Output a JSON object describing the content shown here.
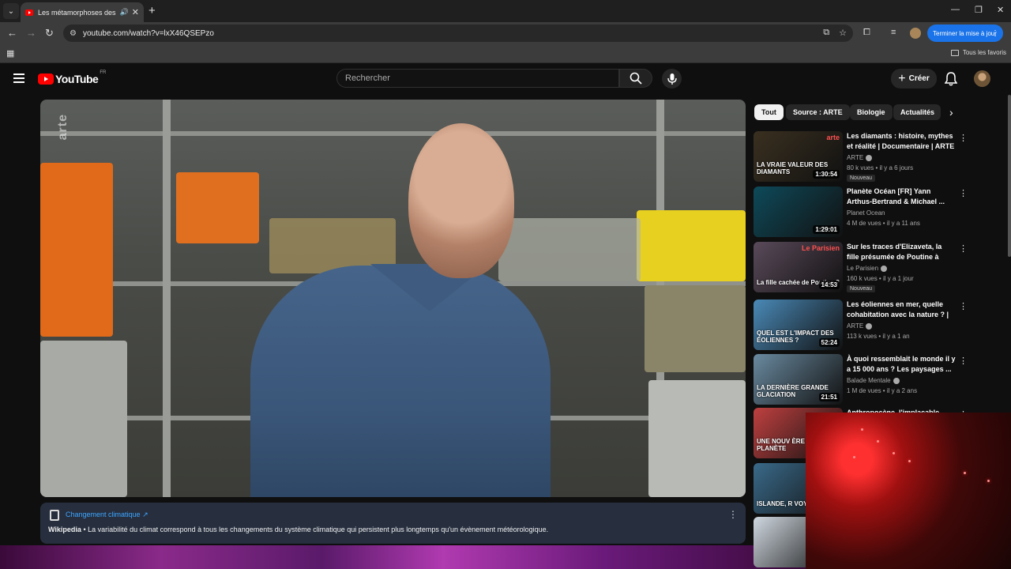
{
  "browser": {
    "tab_title": "Les métamorphoses des gl",
    "url": "youtube.com/watch?v=lxX46QSEPzo",
    "update_button": "Terminer la mise à jour",
    "bookmarks_all": "Tous les favoris"
  },
  "youtube": {
    "logo_text": "YouTube",
    "country_code": "FR",
    "search_placeholder": "Rechercher",
    "create_label": "Créer"
  },
  "player": {
    "watermark": "arte"
  },
  "info_panel": {
    "topic": "Changement climatique",
    "source": "Wikipedia",
    "text": " • La variabilité du climat correspond à tous les changements du système climatique qui persistent plus longtemps qu'un évènement météorologique."
  },
  "chips": [
    "Tout",
    "Source : ARTE",
    "Biologie",
    "Actualités"
  ],
  "recommendations": [
    {
      "title": "Les diamants : histoire, mythes et réalité | Documentaire | ARTE",
      "channel": "ARTE",
      "verified": true,
      "meta": "80 k vues • il y a 6 jours",
      "badge": "Nouveau",
      "duration": "1:30:54",
      "thumb_text": "LA VRAIE VALEUR DES DIAMANTS",
      "thumb_brand": "arte",
      "thumb_color": "#3a3020"
    },
    {
      "title": "Planète Océan [FR] Yann Arthus-Bertrand & Michael ...",
      "channel": "Planet Ocean",
      "verified": false,
      "meta": "4 M de vues • il y a 11 ans",
      "badge": "",
      "duration": "1:29:01",
      "thumb_text": "",
      "thumb_color": "#0e4a5a"
    },
    {
      "title": "Sur les traces d'Elizaveta, la fille présumée de Poutine à Paris",
      "channel": "Le Parisien",
      "verified": true,
      "meta": "160 k vues • il y a 1 jour",
      "badge": "Nouveau",
      "duration": "14:53",
      "thumb_text": "La fille cachée de Poutine ?",
      "thumb_brand": "Le Parisien",
      "thumb_color": "#5a4a5a"
    },
    {
      "title": "Les éoliennes en mer, quelle cohabitation avec la nature ? | ...",
      "channel": "ARTE",
      "verified": true,
      "meta": "113 k vues • il y a 1 an",
      "badge": "",
      "duration": "52:24",
      "thumb_text": "QUEL EST L'IMPACT DES ÉOLIENNES ?",
      "thumb_color": "#4a8ab8"
    },
    {
      "title": "À quoi ressemblait le monde il y a 15 000 ans ? Les paysages ...",
      "channel": "Balade Mentale",
      "verified": true,
      "meta": "1 M de vues • il y a 2 ans",
      "badge": "",
      "duration": "21:51",
      "thumb_text": "LA DERNIÈRE GRANDE GLACIATION",
      "thumb_color": "#6a8aa0"
    },
    {
      "title": "Anthropocène, l'implacable",
      "channel": "",
      "verified": false,
      "meta": "",
      "badge": "",
      "duration": "",
      "thumb_text": "UNE NOUV ÈRE POUR PLANÈTE",
      "thumb_color": "#c04040"
    },
    {
      "title": "",
      "channel": "",
      "verified": false,
      "meta": "",
      "badge": "",
      "duration": "",
      "thumb_text": "ISLANDE, R VOYAG",
      "thumb_color": "#3a6a8a"
    },
    {
      "title": "",
      "channel": "",
      "verified": false,
      "meta": "",
      "badge": "",
      "duration": "",
      "thumb_text": "",
      "thumb_color": "#d0d8e0"
    }
  ]
}
